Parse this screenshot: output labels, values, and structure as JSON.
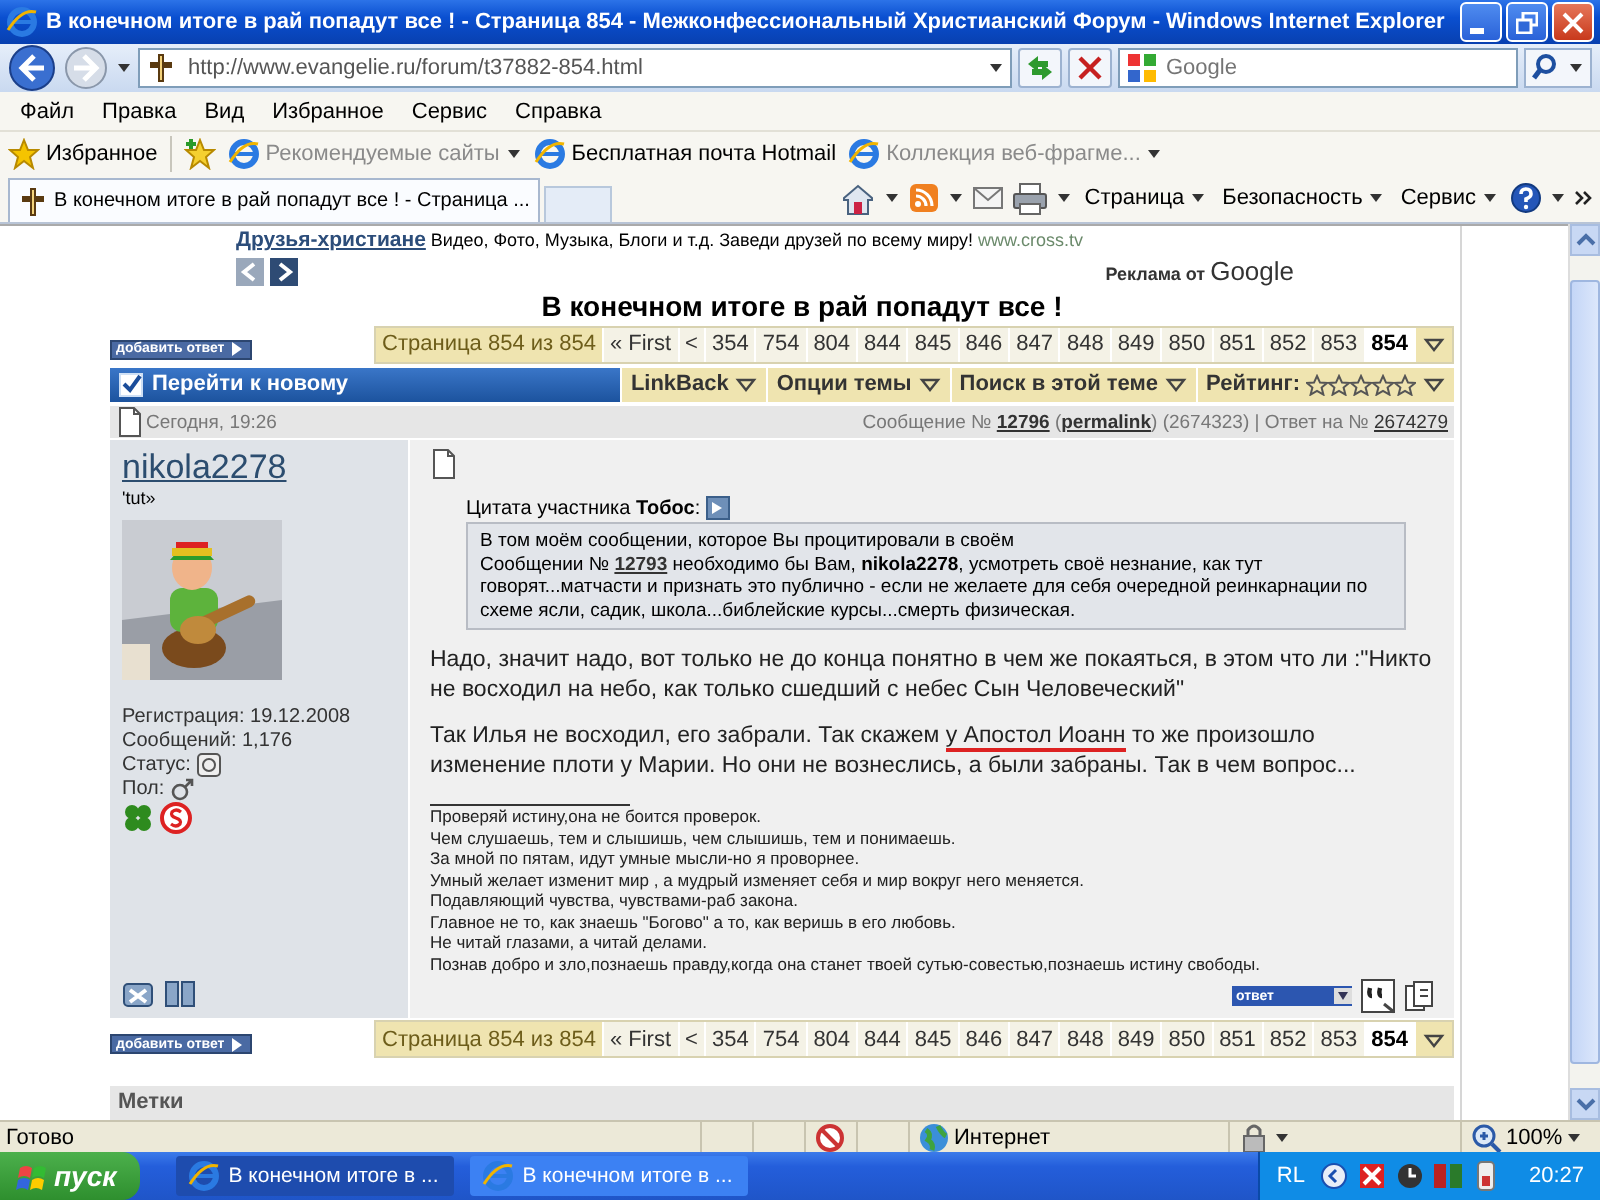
{
  "window": {
    "title": "В конечном итоге в рай попадут все ! - Страница 854 - Межконфессиональный Христианский Форум - Windows Internet Explorer"
  },
  "address": {
    "value": "http://www.evangelie.ru/forum/t37882-854.html"
  },
  "search": {
    "placeholder": "Google"
  },
  "menu": [
    "Файл",
    "Правка",
    "Вид",
    "Избранное",
    "Сервис",
    "Справка"
  ],
  "favorites": {
    "label": "Избранное",
    "items": [
      {
        "label": "Рекомендуемые сайты",
        "dimmed": true,
        "dropdown": true
      },
      {
        "label": "Бесплатная почта Hotmail",
        "dimmed": false,
        "dropdown": false
      },
      {
        "label": "Коллекция веб-фрагме...",
        "dimmed": true,
        "dropdown": true
      }
    ]
  },
  "tabs": [
    {
      "label": "В конечном итоге в рай попадут все ! - Страница ...",
      "selected": true
    }
  ],
  "command_bar": [
    "Страница",
    "Безопасность",
    "Сервис"
  ],
  "page": {
    "ad": {
      "link": "Друзья-христиане",
      "text": " Видео, Фото, Музыка, Блоги и т.д. Заведи друзей по всему миру! ",
      "url": "www.cross.tv",
      "sponsor": "Реклама от",
      "brand": "Google"
    },
    "thread_title": "В конечном итоге в рай попадут все !",
    "top_nav": {
      "reply_button": "добавить ответ",
      "label": "Страница 854 из 854",
      "first": "« First",
      "prev": "<",
      "pages": [
        {
          "label": "354",
          "selected": false
        },
        {
          "label": "754",
          "selected": false
        },
        {
          "label": "804",
          "selected": false
        },
        {
          "label": "844",
          "selected": false
        },
        {
          "label": "845",
          "selected": false
        },
        {
          "label": "846",
          "selected": false
        },
        {
          "label": "847",
          "selected": false
        },
        {
          "label": "848",
          "selected": false
        },
        {
          "label": "849",
          "selected": false
        },
        {
          "label": "850",
          "selected": false
        },
        {
          "label": "851",
          "selected": false
        },
        {
          "label": "852",
          "selected": false
        },
        {
          "label": "853",
          "selected": false
        },
        {
          "label": "854",
          "selected": true
        }
      ]
    },
    "toolbar": {
      "jump": "Перейти к новому",
      "menus": [
        "LinkBack",
        "Опции темы",
        "Поиск в этой теме"
      ],
      "rating": {
        "label": "Рейтинг:",
        "stars": 0
      }
    },
    "post": {
      "date": "Сегодня, 19:26",
      "meta": [
        {
          "kind": "text",
          "text": "Сообщение № "
        },
        {
          "kind": "bold_link",
          "text": "12796"
        },
        {
          "kind": "text",
          "text": " ("
        },
        {
          "kind": "bold_link",
          "text": "permalink"
        },
        {
          "kind": "text",
          "text": ") (2674323) | Ответ на № "
        },
        {
          "kind": "link",
          "text": "2674279"
        }
      ],
      "user": {
        "name": "nikola2278",
        "title": "'tut»",
        "info": [
          {
            "text": "Регистрация: 19.12.2008",
            "kind": "text"
          },
          {
            "text": "Сообщений: 1,176",
            "kind": "text"
          },
          {
            "text": "Статус:",
            "kind": "status"
          },
          {
            "text": "Пол:",
            "kind": "gender"
          }
        ]
      },
      "quote_label": "Цитата участника **Тобос**:",
      "quote": [
        {
          "kind": "text",
          "text": "В том моём сообщении, которое Вы процитировали в своём\nСообщении № "
        },
        {
          "kind": "bold_link",
          "text": "12793"
        },
        {
          "kind": "text",
          "text": " необходимо бы Вам, **nikola2278**, усмотреть своё незнание, как тут говорят...матчасти и признать это публично - если не желаете для себя очередной реинкарнации по схеме ясли, садик, школа...библейские курсы...смерть физическая."
        }
      ],
      "paragraphs": [
        [
          {
            "kind": "text",
            "text": "Надо, значит надо, вот только не до конца понятно в чем же покаяться, в этом что ли :\"Никто не восходил на небо, как только сшедший с небес Сын Человеческий\""
          }
        ],
        [
          {
            "kind": "text",
            "text": "Так Илья не восходил, его забрали. Так скажем "
          },
          {
            "kind": "marked",
            "text": "у Апостол Иоанн"
          },
          {
            "kind": "text",
            "text": " то же произошло изменение плоти у Марии. Но они не вознеслись, а были забраны. Так в чем вопрос..."
          }
        ]
      ],
      "signature": [
        "Проверяй истину,она не боится проверок.",
        "Чем слушаешь, тем и слышишь, чем слышишь, тем и понимаешь.",
        "За мной по пятам, идут умные мысли-но я проворнее.",
        "Умный желает изменит мир , а мудрый изменяет себя и мир вокруг него меняется.",
        "Подавляющий чувства, чувствами-раб закона.",
        "Главное не то, как знаешь \"Богово\" а то, как веришь в его любовь.",
        "Не читай глазами, а читай делами.",
        "Познав добро и зло,познаешь правду,когда она станет твоей сутью-совестью,познаешь истину свободы."
      ],
      "reply_select": "ответ"
    },
    "bottom_nav": {
      "reply_button": "добавить ответ",
      "label": "Страница 854 из 854",
      "first": "« First",
      "prev": "<",
      "pages": [
        {
          "label": "354",
          "selected": false
        },
        {
          "label": "754",
          "selected": false
        },
        {
          "label": "804",
          "selected": false
        },
        {
          "label": "844",
          "selected": false
        },
        {
          "label": "845",
          "selected": false
        },
        {
          "label": "846",
          "selected": false
        },
        {
          "label": "847",
          "selected": false
        },
        {
          "label": "848",
          "selected": false
        },
        {
          "label": "849",
          "selected": false
        },
        {
          "label": "850",
          "selected": false
        },
        {
          "label": "851",
          "selected": false
        },
        {
          "label": "852",
          "selected": false
        },
        {
          "label": "853",
          "selected": false
        },
        {
          "label": "854",
          "selected": true
        }
      ]
    },
    "tags_header": "Метки"
  },
  "status_bar": {
    "text": "Готово",
    "zone": "Интернет",
    "zoom": "100%"
  },
  "taskbar": {
    "start": "пуск",
    "tasks": [
      {
        "label": "В конечном итоге в ...",
        "selected": true
      },
      {
        "label": "В конечном итоге в ...",
        "selected": false
      }
    ],
    "lang": "RL",
    "time": "20:27"
  }
}
